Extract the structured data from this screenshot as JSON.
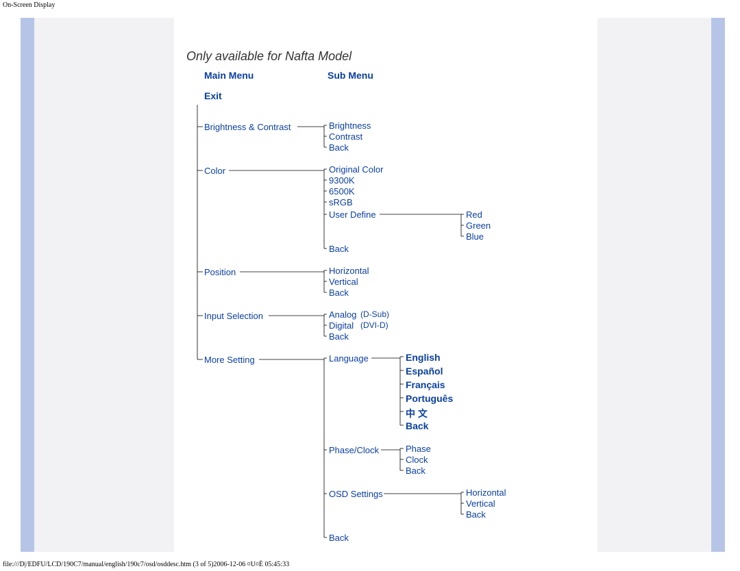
{
  "header": "On-Screen Display",
  "footer": "file:///D|/EDFU/LCD/190C7/manual/english/190c7/osd/osddesc.htm (3 of 5)2006-12-06 ¤U¤È 05:45:33",
  "title": "Only available for Nafta Model",
  "col_main": "Main Menu",
  "col_sub": "Sub Menu",
  "exit": "Exit",
  "bc": "Brightness &  Contrast",
  "bc_sub": {
    "a": "Brightness",
    "b": "Contrast",
    "c": "Back"
  },
  "color": "Color",
  "color_sub": {
    "a": "Original Color",
    "b": "9300K",
    "c": "6500K",
    "d": "sRGB",
    "e": "User Define",
    "f": "Back"
  },
  "ud_sub": {
    "a": "Red",
    "b": "Green",
    "c": "Blue"
  },
  "position": "Position",
  "pos_sub": {
    "a": "Horizontal",
    "b": "Vertical",
    "c": "Back"
  },
  "input": "Input Selection",
  "input_sub": {
    "a": "Analog",
    "an": "(D-Sub)",
    "b": "Digital",
    "bn": "(DVI-D)",
    "c": "Back"
  },
  "more": "More Setting",
  "ms_lang": "Language",
  "lang": {
    "a": "English",
    "b": "Español",
    "c": "Français",
    "d": "Português",
    "e": "中 文",
    "f": "Back"
  },
  "ms_pc": "Phase/Clock",
  "pc_sub": {
    "a": "Phase",
    "b": "Clock",
    "c": "Back"
  },
  "ms_osd": "OSD Settings",
  "osd_sub": {
    "a": "Horizontal",
    "b": "Vertical",
    "c": "Back"
  },
  "ms_back": "Back"
}
